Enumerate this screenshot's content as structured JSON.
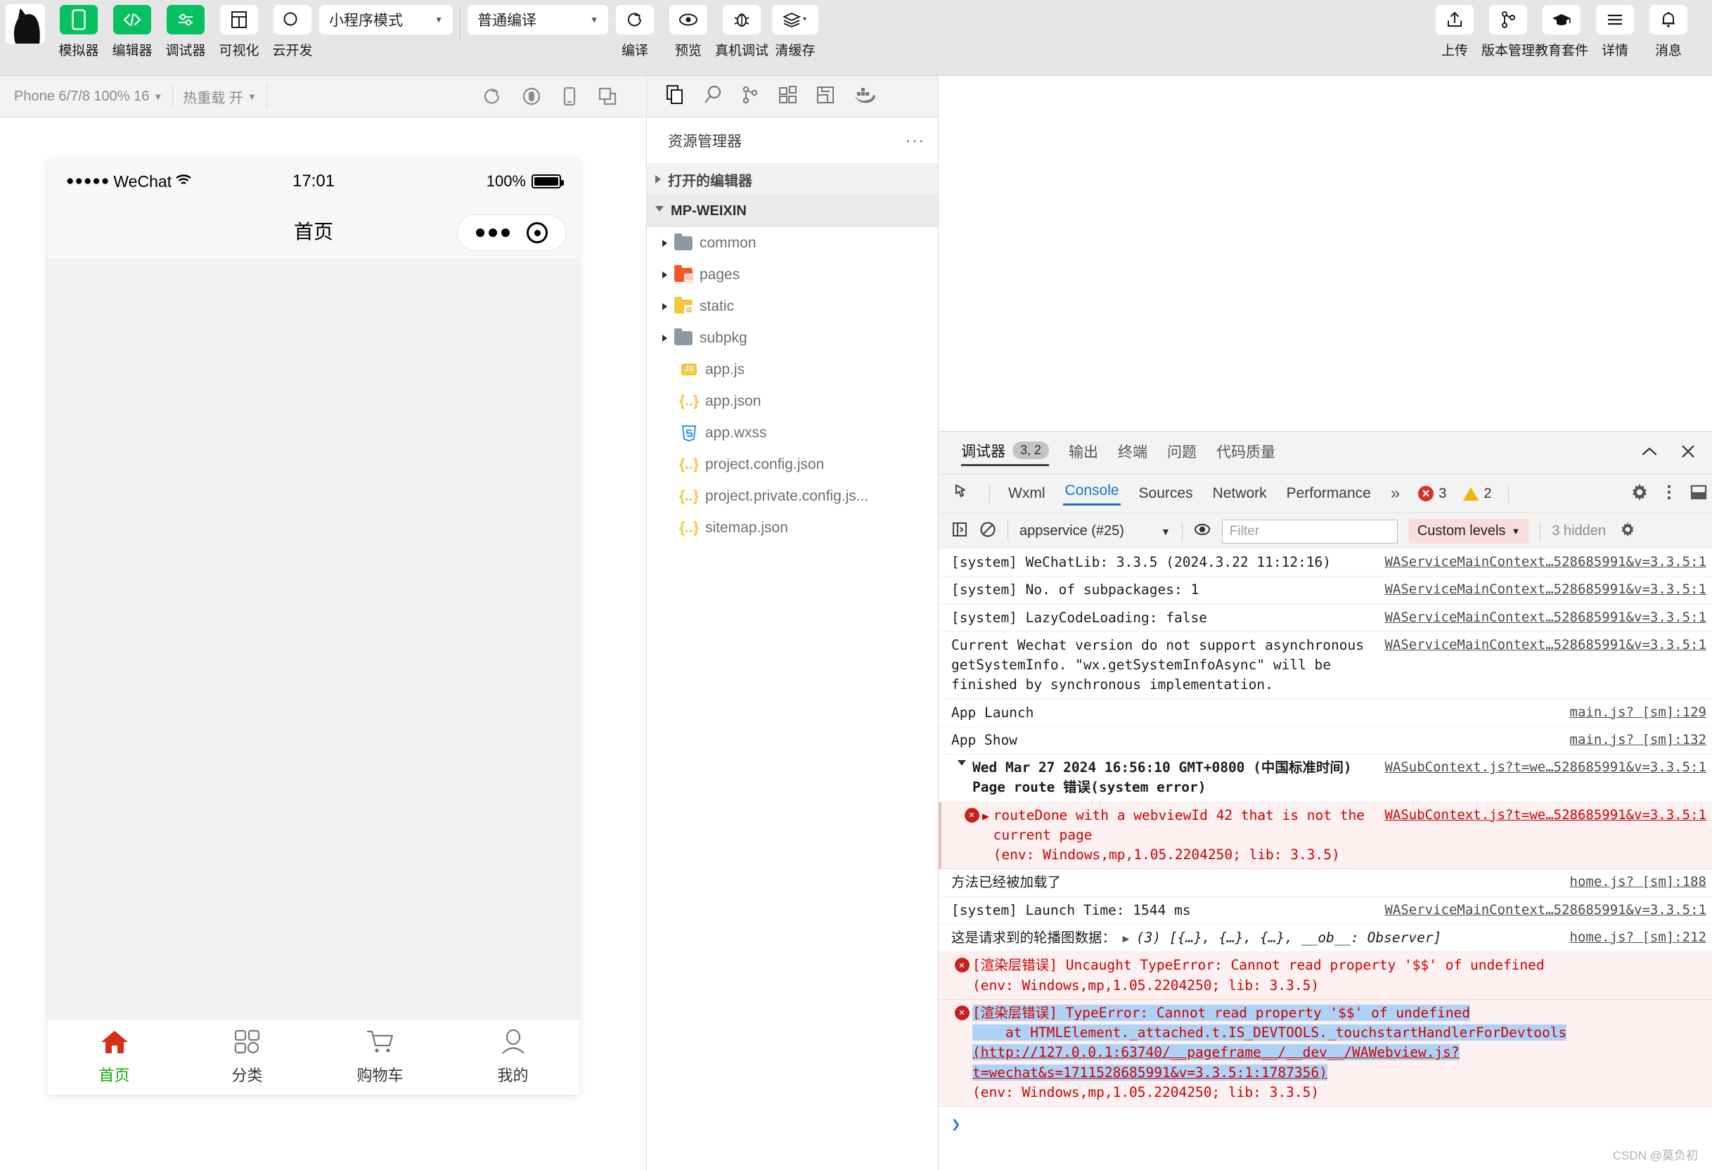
{
  "toolbar": {
    "left_items": [
      {
        "label": "模拟器",
        "icon": "phone-icon",
        "active": true
      },
      {
        "label": "编辑器",
        "icon": "code-icon",
        "active": true
      },
      {
        "label": "调试器",
        "icon": "sliders-icon",
        "active": true
      },
      {
        "label": "可视化",
        "icon": "layout-icon",
        "active": false
      },
      {
        "label": "云开发",
        "icon": "cloud-icon",
        "active": false
      }
    ],
    "mode_select": "小程序模式",
    "compile_select": "普通编译",
    "action_items": [
      {
        "label": "编译",
        "icon": "refresh-icon"
      },
      {
        "label": "预览",
        "icon": "eye-icon"
      },
      {
        "label": "真机调试",
        "icon": "bug-icon"
      },
      {
        "label": "清缓存",
        "icon": "layers-icon"
      }
    ],
    "right_items": [
      {
        "label": "上传",
        "icon": "upload-icon"
      },
      {
        "label": "版本管理",
        "icon": "branch-icon"
      },
      {
        "label": "教育套件",
        "icon": "graduation-cap-icon"
      },
      {
        "label": "详情",
        "icon": "menu-icon"
      },
      {
        "label": "消息",
        "icon": "bell-icon"
      }
    ]
  },
  "simulator": {
    "device_select": "Phone 6/7/8 100% 16",
    "hot_reload_select": "热重载 开",
    "toolbar_icons": [
      "refresh-icon",
      "record-icon",
      "device-rotate-icon",
      "multi-window-icon"
    ],
    "status_bar": {
      "carrier": "WeChat",
      "signal_dots": "●●●●●",
      "wifi": "wifi-icon",
      "time": "17:01",
      "battery_percent": "100%"
    },
    "nav_title": "首页",
    "tabbar": [
      {
        "label": "首页",
        "icon": "home-icon",
        "active": true
      },
      {
        "label": "分类",
        "icon": "grid-search-icon",
        "active": false
      },
      {
        "label": "购物车",
        "icon": "cart-icon",
        "active": false
      },
      {
        "label": "我的",
        "icon": "user-icon",
        "active": false
      }
    ]
  },
  "explorer": {
    "action_icons": [
      "files-icon",
      "search-icon",
      "source-control-icon",
      "extensions-icon",
      "save-layout-icon",
      "docker-icon"
    ],
    "title": "资源管理器",
    "more": "···",
    "sections": [
      {
        "label": "打开的编辑器",
        "expanded": false
      },
      {
        "label": "MP-WEIXIN",
        "expanded": true
      }
    ],
    "tree": [
      {
        "label": "common",
        "type": "folder",
        "color": "#8a9aa5",
        "expanded": false,
        "chip": ""
      },
      {
        "label": "pages",
        "type": "folder",
        "color": "#f4562b",
        "expanded": false,
        "chip": "<>"
      },
      {
        "label": "static",
        "type": "folder",
        "color": "#f5c53d",
        "expanded": false,
        "chip": "▤"
      },
      {
        "label": "subpkg",
        "type": "folder",
        "color": "#8a9aa5",
        "expanded": false,
        "chip": ""
      },
      {
        "label": "app.js",
        "type": "js",
        "color": "#f5c53d",
        "badge": "JS"
      },
      {
        "label": "app.json",
        "type": "json",
        "color": "#f5c53d",
        "badge": "{..}"
      },
      {
        "label": "app.wxss",
        "type": "css",
        "color": "#2196f3",
        "badge": "≡"
      },
      {
        "label": "project.config.json",
        "type": "json",
        "color": "#f5c53d",
        "badge": "{..}"
      },
      {
        "label": "project.private.config.js...",
        "type": "json",
        "color": "#f5c53d",
        "badge": "{..}"
      },
      {
        "label": "sitemap.json",
        "type": "json",
        "color": "#f5c53d",
        "badge": "{..}"
      }
    ]
  },
  "debugger": {
    "panel_tabs": [
      {
        "label": "调试器",
        "badge": "3, 2",
        "active": true
      },
      {
        "label": "输出",
        "badge": "",
        "active": false
      },
      {
        "label": "终端",
        "badge": "",
        "active": false
      },
      {
        "label": "问题",
        "badge": "",
        "active": false
      },
      {
        "label": "代码质量",
        "badge": "",
        "active": false
      }
    ],
    "panel_controls": [
      "chevron-up-icon",
      "close-icon"
    ],
    "devtools_tabs": [
      {
        "label": "Wxml",
        "active": false
      },
      {
        "label": "Console",
        "active": true
      },
      {
        "label": "Sources",
        "active": false
      },
      {
        "label": "Network",
        "active": false
      },
      {
        "label": "Performance",
        "active": false
      }
    ],
    "overflow": "»",
    "error_count": "3",
    "warning_count": "2",
    "right_icons": [
      "settings-gear-icon",
      "more-vertical-icon",
      "dock-icon"
    ],
    "console_toolbar": {
      "sidebar_toggle": "console-sidebar-icon",
      "clear": "clear-console-icon",
      "context": "appservice (#25)",
      "eye": "eye-icon",
      "filter_placeholder": "Filter",
      "filter_value": "",
      "levels": "Custom levels",
      "hidden": "3 hidden",
      "settings": "settings-gear-icon"
    },
    "logs": [
      {
        "level": "info",
        "message": "[system] WeChatLib: 3.3.5 (2024.3.22 11:12:16)",
        "source": "WAServiceMainContext…528685991&v=3.3.5:1"
      },
      {
        "level": "info",
        "message": "[system] No. of subpackages: 1",
        "source": "WAServiceMainContext…528685991&v=3.3.5:1"
      },
      {
        "level": "info",
        "message": "[system] LazyCodeLoading: false",
        "source": "WAServiceMainContext…528685991&v=3.3.5:1"
      },
      {
        "level": "info",
        "message": "Current Wechat version do not support asynchronous getSystemInfo. \"wx.getSystemInfoAsync\" will be finished by synchronous implementation.",
        "source": "WAServiceMainContext…528685991&v=3.3.5:1"
      },
      {
        "level": "info",
        "message": "App Launch",
        "source": "main.js? [sm]:129"
      },
      {
        "level": "info",
        "message": "App Show",
        "source": "main.js? [sm]:132"
      },
      {
        "level": "group",
        "message": "Wed Mar 27 2024 16:56:10 GMT+0800 (中国标准时间) Page route 错误(system error)",
        "source": "WASubContext.js?t=we…528685991&v=3.3.5:1"
      },
      {
        "level": "error-nested",
        "message": "routeDone with a webviewId 42 that is not the current page\n(env: Windows,mp,1.05.2204250; lib: 3.3.5)",
        "source": "WASubContext.js?t=we…528685991&v=3.3.5:1"
      },
      {
        "level": "info",
        "message": "方法已经被加载了",
        "source": "home.js? [sm]:188"
      },
      {
        "level": "info",
        "message": "[system] Launch Time: 1544 ms",
        "source": "WAServiceMainContext…528685991&v=3.3.5:1"
      },
      {
        "level": "object",
        "message": "这是请求到的轮播图数据：",
        "object": "(3) [{…}, {…}, {…}, __ob__: Observer]",
        "source": "home.js? [sm]:212"
      },
      {
        "level": "error",
        "message": "[渲染层错误] Uncaught TypeError: Cannot read property '$$' of undefined\n(env: Windows,mp,1.05.2204250; lib: 3.3.5)",
        "source": ""
      },
      {
        "level": "error-selected",
        "line1": "[渲染层错误] TypeError: Cannot read property '$$' of undefined",
        "line2": "    at HTMLElement._attached.t.IS_DEVTOOLS._touchstartHandlerForDevtools",
        "line3": "(http://127.0.0.1:63740/__pageframe__/__dev__/WAWebview.js?t=wechat&s=1711528685991&v=3.3.5:1:1787356)",
        "line4": "(env: Windows,mp,1.05.2204250; lib: 3.3.5)",
        "source": ""
      }
    ],
    "prompt": "❯"
  },
  "watermark": "CSDN @莫负初",
  "colors": {
    "wechat_green": "#07c160",
    "error_red": "#cc0000",
    "selection_blue": "#aed2f5",
    "tab_active_blue": "#1a73c9",
    "tab_active_green": "#13a800",
    "home_icon_red": "#d32f1a"
  }
}
